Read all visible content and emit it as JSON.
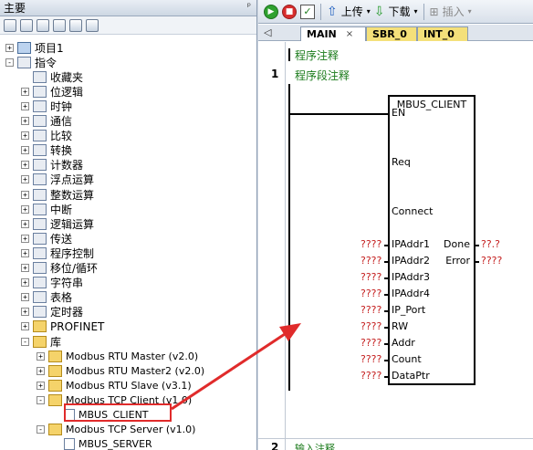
{
  "left_pane": {
    "title": "主要",
    "tree": [
      {
        "label": "项目1",
        "level": 0,
        "expander": "+",
        "icon": "project"
      },
      {
        "label": "指令",
        "level": 0,
        "expander": "-",
        "icon": "block"
      },
      {
        "label": "收藏夹",
        "level": 1,
        "expander": "",
        "icon": "block"
      },
      {
        "label": "位逻辑",
        "level": 1,
        "expander": "+",
        "icon": "block"
      },
      {
        "label": "时钟",
        "level": 1,
        "expander": "+",
        "icon": "block"
      },
      {
        "label": "通信",
        "level": 1,
        "expander": "+",
        "icon": "block"
      },
      {
        "label": "比较",
        "level": 1,
        "expander": "+",
        "icon": "block"
      },
      {
        "label": "转换",
        "level": 1,
        "expander": "+",
        "icon": "block"
      },
      {
        "label": "计数器",
        "level": 1,
        "expander": "+",
        "icon": "block"
      },
      {
        "label": "浮点运算",
        "level": 1,
        "expander": "+",
        "icon": "block"
      },
      {
        "label": "整数运算",
        "level": 1,
        "expander": "+",
        "icon": "block"
      },
      {
        "label": "中断",
        "level": 1,
        "expander": "+",
        "icon": "block"
      },
      {
        "label": "逻辑运算",
        "level": 1,
        "expander": "+",
        "icon": "block"
      },
      {
        "label": "传送",
        "level": 1,
        "expander": "+",
        "icon": "block"
      },
      {
        "label": "程序控制",
        "level": 1,
        "expander": "+",
        "icon": "block"
      },
      {
        "label": "移位/循环",
        "level": 1,
        "expander": "+",
        "icon": "block"
      },
      {
        "label": "字符串",
        "level": 1,
        "expander": "+",
        "icon": "block"
      },
      {
        "label": "表格",
        "level": 1,
        "expander": "+",
        "icon": "block"
      },
      {
        "label": "定时器",
        "level": 1,
        "expander": "+",
        "icon": "block"
      },
      {
        "label": "PROFINET",
        "level": 1,
        "expander": "+",
        "icon": "folder"
      },
      {
        "label": "库",
        "level": 1,
        "expander": "-",
        "icon": "folder"
      },
      {
        "label": "Modbus RTU Master (v2.0)",
        "level": 2,
        "expander": "+",
        "icon": "folder"
      },
      {
        "label": "Modbus RTU Master2 (v2.0)",
        "level": 2,
        "expander": "+",
        "icon": "folder"
      },
      {
        "label": "Modbus RTU Slave (v3.1)",
        "level": 2,
        "expander": "+",
        "icon": "folder"
      },
      {
        "label": "Modbus TCP Client (v1.0)",
        "level": 2,
        "expander": "-",
        "icon": "folder"
      },
      {
        "label": "MBUS_CLIENT",
        "level": 3,
        "expander": "",
        "icon": "doc"
      },
      {
        "label": "Modbus TCP Server (v1.0)",
        "level": 2,
        "expander": "-",
        "icon": "folder"
      },
      {
        "label": "MBUS_SERVER",
        "level": 3,
        "expander": "",
        "icon": "doc"
      }
    ]
  },
  "toolbar": {
    "upload_label": "上传",
    "download_label": "下载",
    "insert_label": "插入"
  },
  "tabs": [
    {
      "label": "MAIN",
      "close": "×"
    },
    {
      "label": "SBR_0"
    },
    {
      "label": "INT_0"
    }
  ],
  "editor": {
    "program_comment": "程序注释",
    "rung1_number": "1",
    "rung1_comment": "程序段注释",
    "rung2_number": "2",
    "rung2_comment": "输入注释",
    "block": {
      "title": "MBUS_CLIENT",
      "inputs": [
        "EN",
        "Req",
        "Connect",
        "IPAddr1",
        "IPAddr2",
        "IPAddr3",
        "IPAddr4",
        "IP_Port",
        "RW",
        "Addr",
        "Count",
        "DataPtr"
      ],
      "input_values": [
        "",
        "",
        "",
        "????",
        "????",
        "????",
        "????",
        "????",
        "????",
        "????",
        "????",
        "????"
      ],
      "outputs": [
        "Done",
        "Error"
      ],
      "output_values": [
        "??.?",
        "????"
      ]
    }
  },
  "colors": {
    "highlight": "#e02b2b",
    "comment": "#1b7b1b",
    "unassigned": "#c41e1e"
  }
}
